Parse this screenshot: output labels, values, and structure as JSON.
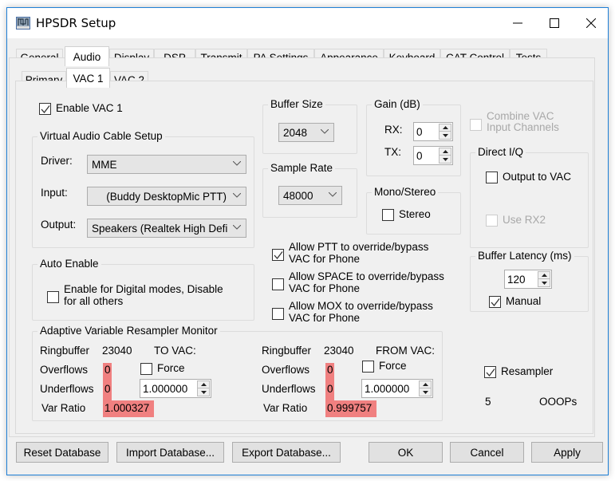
{
  "window": {
    "title": "HPSDR Setup",
    "controls": {
      "minimize": "minimize-icon",
      "maximize": "maximize-icon",
      "close": "close-icon"
    }
  },
  "main_tabs": [
    {
      "label": "General"
    },
    {
      "label": "Audio",
      "active": true
    },
    {
      "label": "Display"
    },
    {
      "label": "DSP"
    },
    {
      "label": "Transmit"
    },
    {
      "label": "PA Settings"
    },
    {
      "label": "Appearance"
    },
    {
      "label": "Keyboard"
    },
    {
      "label": "CAT Control"
    },
    {
      "label": "Tests"
    }
  ],
  "sub_tabs": [
    {
      "label": "Primary"
    },
    {
      "label": "VAC 1",
      "active": true
    },
    {
      "label": "VAC 2"
    }
  ],
  "vac": {
    "enable_label": "Enable VAC 1",
    "enable_checked": true,
    "setup": {
      "title": "Virtual Audio Cable Setup",
      "driver_label": "Driver:",
      "driver_value": "MME",
      "input_label": "Input:",
      "input_value": "(Buddy DesktopMic PTT)",
      "output_label": "Output:",
      "output_value": "Speakers (Realtek High Defi"
    },
    "buffer_size": {
      "title": "Buffer Size",
      "value": "2048"
    },
    "sample_rate": {
      "title": "Sample Rate",
      "value": "48000"
    },
    "gain": {
      "title": "Gain (dB)",
      "rx_label": "RX:",
      "rx_value": "0",
      "tx_label": "TX:",
      "tx_value": "0"
    },
    "mono_stereo": {
      "title": "Mono/Stereo",
      "stereo_label": "Stereo",
      "stereo_checked": false
    },
    "combine": {
      "label_line1": "Combine VAC",
      "label_line2": "Input Channels",
      "checked": false,
      "disabled": true
    },
    "direct_iq": {
      "title": "Direct I/Q",
      "output_label": "Output to VAC",
      "output_checked": false,
      "rx2_label": "Use RX2",
      "rx2_checked": false
    },
    "latency": {
      "title": "Buffer Latency (ms)",
      "value": "120",
      "manual_label": "Manual",
      "manual_checked": true
    },
    "auto_enable": {
      "title": "Auto Enable",
      "line1": "Enable for Digital modes, Disable",
      "line2": "for all others",
      "checked": false
    },
    "overrides": [
      {
        "line1": "Allow PTT to override/bypass",
        "line2": "VAC for Phone",
        "checked": true
      },
      {
        "line1": "Allow SPACE to override/bypass",
        "line2": "VAC for Phone",
        "checked": false
      },
      {
        "line1": "Allow MOX to override/bypass",
        "line2": "VAC for Phone",
        "checked": false
      }
    ],
    "resampler_monitor": {
      "title": "Adaptive Variable Resampler Monitor",
      "to_vac": {
        "ringbuffer_label": "Ringbuffer",
        "ringbuffer_value": "23040",
        "direction": "TO VAC:",
        "overflows_label": "Overflows",
        "overflows_value": "0",
        "underflows_label": "Underflows",
        "underflows_value": "0",
        "var_ratio_label": "Var Ratio",
        "var_ratio_value": "1.000327",
        "force_label": "Force",
        "force_checked": false,
        "force_value": "1.000000"
      },
      "from_vac": {
        "ringbuffer_label": "Ringbuffer",
        "ringbuffer_value": "23040",
        "direction": "FROM VAC:",
        "overflows_label": "Overflows",
        "overflows_value": "0",
        "underflows_label": "Underflows",
        "underflows_value": "0",
        "var_ratio_label": "Var Ratio",
        "var_ratio_value": "0.999757",
        "force_label": "Force",
        "force_checked": false,
        "force_value": "1.000000"
      }
    },
    "resampler": {
      "label": "Resampler",
      "checked": true,
      "count": "5",
      "ooops_label": "OOOPs"
    }
  },
  "footer": {
    "reset": "Reset Database",
    "import": "Import Database...",
    "export": "Export Database...",
    "ok": "OK",
    "cancel": "Cancel",
    "apply": "Apply"
  },
  "colors": {
    "alert_red": "#f08080",
    "window_border": "#1e7fd6",
    "face": "#f0f0f0"
  }
}
